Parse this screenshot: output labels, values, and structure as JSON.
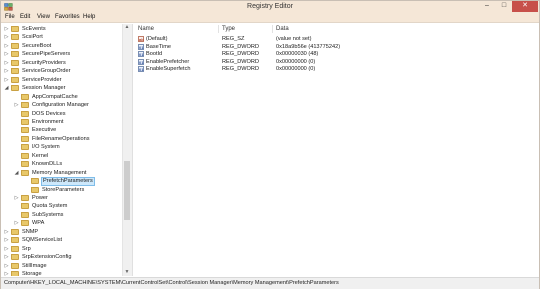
{
  "window": {
    "title": "Registry Editor"
  },
  "title_buttons": {
    "minimize": "–",
    "maximize": "□",
    "close": "✕"
  },
  "menu": [
    "File",
    "Edit",
    "View",
    "Favorites",
    "Help"
  ],
  "tree": {
    "items": [
      {
        "label": "ScEvents",
        "expander": "▷"
      },
      {
        "label": "ScsiPort",
        "expander": "▷"
      },
      {
        "label": "SecureBoot",
        "expander": "▷"
      },
      {
        "label": "SecurePipeServers",
        "expander": "▷"
      },
      {
        "label": "SecurityProviders",
        "expander": "▷"
      },
      {
        "label": "ServiceGroupOrder",
        "expander": "▷"
      },
      {
        "label": "ServiceProvider",
        "expander": "▷"
      },
      {
        "label": "Session Manager",
        "expander": "◢"
      },
      {
        "label": "AppCompatCache",
        "expander": ""
      },
      {
        "label": "Configuration Manager",
        "expander": "▷"
      },
      {
        "label": "DOS Devices",
        "expander": ""
      },
      {
        "label": "Environment",
        "expander": ""
      },
      {
        "label": "Executive",
        "expander": ""
      },
      {
        "label": "FileRenameOperations",
        "expander": ""
      },
      {
        "label": "I/O System",
        "expander": ""
      },
      {
        "label": "Kernel",
        "expander": ""
      },
      {
        "label": "KnownDLLs",
        "expander": ""
      },
      {
        "label": "Memory Management",
        "expander": "◢"
      },
      {
        "label": "PrefetchParameters",
        "expander": "",
        "selected": true
      },
      {
        "label": "StoreParameters",
        "expander": ""
      },
      {
        "label": "Power",
        "expander": "▷"
      },
      {
        "label": "Quota System",
        "expander": ""
      },
      {
        "label": "SubSystems",
        "expander": ""
      },
      {
        "label": "WPA",
        "expander": "▷"
      },
      {
        "label": "SNMP",
        "expander": "▷"
      },
      {
        "label": "SQMServiceList",
        "expander": "▷"
      },
      {
        "label": "Srp",
        "expander": "▷"
      },
      {
        "label": "SrpExtensionConfig",
        "expander": "▷"
      },
      {
        "label": "StillImage",
        "expander": "▷"
      },
      {
        "label": "Storage",
        "expander": "▷"
      }
    ]
  },
  "values": {
    "headers": {
      "name": "Name",
      "type": "Type",
      "data": "Data"
    },
    "rows": [
      {
        "icon": "ab",
        "icon_name": "string-value-icon",
        "name": "(Default)",
        "type": "REG_SZ",
        "data": "(value not set)"
      },
      {
        "icon": "01",
        "icon_name": "dword-value-icon",
        "name": "BaseTime",
        "type": "REG_DWORD",
        "data": "0x18a9b56e (413775242)"
      },
      {
        "icon": "01",
        "icon_name": "dword-value-icon",
        "name": "BootId",
        "type": "REG_DWORD",
        "data": "0x00000030 (48)"
      },
      {
        "icon": "01",
        "icon_name": "dword-value-icon",
        "name": "EnablePrefetcher",
        "type": "REG_DWORD",
        "data": "0x00000000 (0)"
      },
      {
        "icon": "01",
        "icon_name": "dword-value-icon",
        "name": "EnableSuperfetch",
        "type": "REG_DWORD",
        "data": "0x00000000 (0)"
      }
    ]
  },
  "status": {
    "path": "Computer\\HKEY_LOCAL_MACHINE\\SYSTEM\\CurrentControlSet\\Control\\Session Manager\\Memory Management\\PrefetchParameters"
  },
  "colors": {
    "titlebar": "#f5e7d7",
    "close": "#c7504a",
    "selection": "#cde8fb",
    "folder": "#e8c86a"
  }
}
